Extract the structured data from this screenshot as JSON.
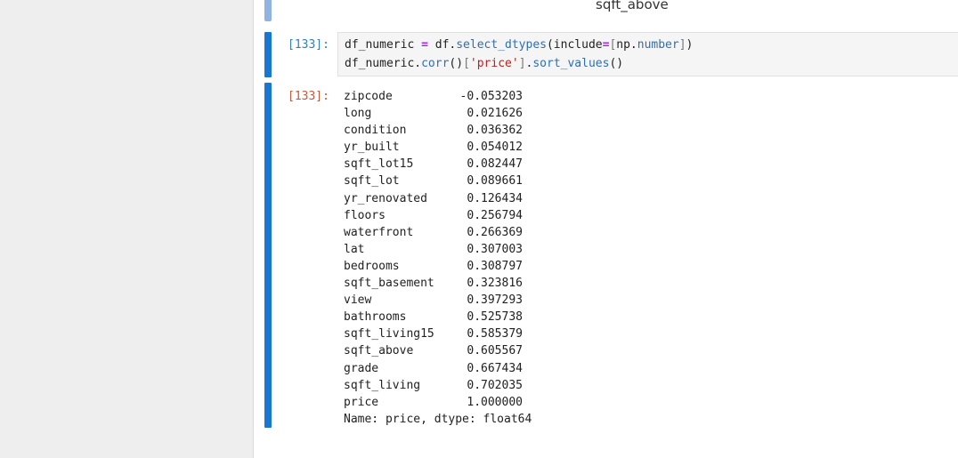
{
  "previous_cell": {
    "label": "sqft_above"
  },
  "input_cell": {
    "prompt": "[133]:",
    "line1": {
      "p1": "df_numeric ",
      "op1": "=",
      "p2": " df.",
      "fn1": "select_dtypes",
      "p3": "(include",
      "op2": "=",
      "br1": "[",
      "p4": "np.",
      "attr1": "number",
      "br2": "]",
      "p5": ")"
    },
    "line2": {
      "p1": "df_numeric.",
      "fn1": "corr",
      "p2": "()",
      "br1": "[",
      "str1": "'price'",
      "br2": "]",
      "p3": ".",
      "fn2": "sort_values",
      "p4": "()"
    }
  },
  "output_cell": {
    "prompt": "[133]:",
    "rows": [
      {
        "name": "zipcode",
        "value": "-0.053203"
      },
      {
        "name": "long",
        "value": "0.021626"
      },
      {
        "name": "condition",
        "value": "0.036362"
      },
      {
        "name": "yr_built",
        "value": "0.054012"
      },
      {
        "name": "sqft_lot15",
        "value": "0.082447"
      },
      {
        "name": "sqft_lot",
        "value": "0.089661"
      },
      {
        "name": "yr_renovated",
        "value": "0.126434"
      },
      {
        "name": "floors",
        "value": "0.256794"
      },
      {
        "name": "waterfront",
        "value": "0.266369"
      },
      {
        "name": "lat",
        "value": "0.307003"
      },
      {
        "name": "bedrooms",
        "value": "0.308797"
      },
      {
        "name": "sqft_basement",
        "value": "0.323816"
      },
      {
        "name": "view",
        "value": "0.397293"
      },
      {
        "name": "bathrooms",
        "value": "0.525738"
      },
      {
        "name": "sqft_living15",
        "value": "0.585379"
      },
      {
        "name": "sqft_above",
        "value": "0.605567"
      },
      {
        "name": "grade",
        "value": "0.667434"
      },
      {
        "name": "sqft_living",
        "value": "0.702035"
      },
      {
        "name": "price",
        "value": "1.000000"
      }
    ],
    "footer": "Name: price, dtype: float64"
  },
  "colors": {
    "active_cell_bar": "#1976d2",
    "previous_cell_bar": "#8fb4e3",
    "in_prompt": "#307fc1",
    "out_prompt": "#bf5b3d",
    "code_background": "#f5f5f5"
  }
}
